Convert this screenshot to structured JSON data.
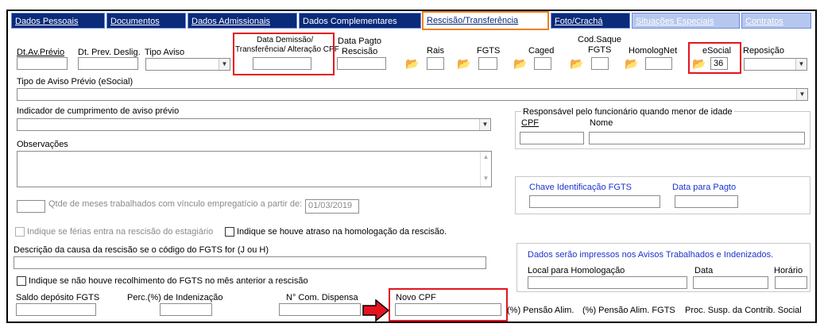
{
  "tabs": [
    {
      "label": "Dados Pessoais"
    },
    {
      "label": "Documentos"
    },
    {
      "label": "Dados Admissionais"
    },
    {
      "label": "Dados Complementares"
    },
    {
      "label": "Rescisão/Transferência"
    },
    {
      "label": "Foto/Crachá"
    },
    {
      "label": "Situações Especiais"
    },
    {
      "label": "Contratos"
    }
  ],
  "row1": {
    "dt_av_previo": "Dt.Av.Prévio",
    "dt_prev_deslig": "Dt. Prev. Deslig.",
    "tipo_aviso": "Tipo Aviso",
    "data_demissao_line1": "Data Demissão/",
    "data_demissao_line2": "Transferência/ Alteração CPF",
    "data_pagto_line1": "Data Pagto",
    "data_pagto_line2": "Rescisão",
    "rais": "Rais",
    "fgts": "FGTS",
    "caged": "Caged",
    "cod_saque_line1": "Cod.Saque",
    "cod_saque_line2": "FGTS",
    "homolognet": "HomologNet",
    "esocial": "eSocial",
    "esocial_value": "36",
    "reposicao": "Reposição"
  },
  "tipo_aviso_esocial": "Tipo de Aviso Prévio (eSocial)",
  "indicador_aviso": "Indicador de cumprimento de aviso prévio",
  "responsavel": {
    "title": "Responsável pelo funcionário quando menor de idade",
    "cpf": "CPF",
    "nome": "Nome"
  },
  "observacoes": "Observações",
  "qtde_meses": "Qtde de meses trabalhados com vínculo empregatício a partir de:",
  "qtde_date": "01/03/2019",
  "chave": {
    "label": "Chave Identificação FGTS",
    "data_pagto": "Data para Pagto"
  },
  "checkboxes": {
    "ferias_estagiario": "Indique se férias entra na rescisão do estagiário",
    "atraso_homologacao": "Indique se houve atraso na homologação da rescisão.",
    "recolhimento_fgts": "Indique se não houve recolhimento do FGTS no mês anterior a rescisão"
  },
  "descricao_causa": "Descrição da causa da rescisão se o código do FGTS for (J ou H)",
  "avisos": {
    "title": "Dados serão impressos nos Avisos Trabalhados e Indenizados.",
    "local": "Local para Homologação",
    "data": "Data",
    "horario": "Horário"
  },
  "bottom": {
    "saldo": "Saldo depósito FGTS",
    "perc": "Perc.(%)  de Indenização",
    "ncom": "N° Com. Dispensa",
    "novo_cpf": "Novo CPF",
    "pensao": "(%) Pensão Alim.",
    "pensao_fgts": "(%) Pensão Alim. FGTS",
    "proc_susp": "Proc. Susp. da Contrib. Social"
  },
  "colors": {
    "tab_dark": "#0a2a7a",
    "tab_light": "#b6c7ef",
    "active_border": "#ef7f1a",
    "highlight_red": "#e3141f",
    "blue_text": "#1a33cc"
  },
  "icons": [
    "folder-icon",
    "chevron-down-icon",
    "arrow-right-icon"
  ]
}
